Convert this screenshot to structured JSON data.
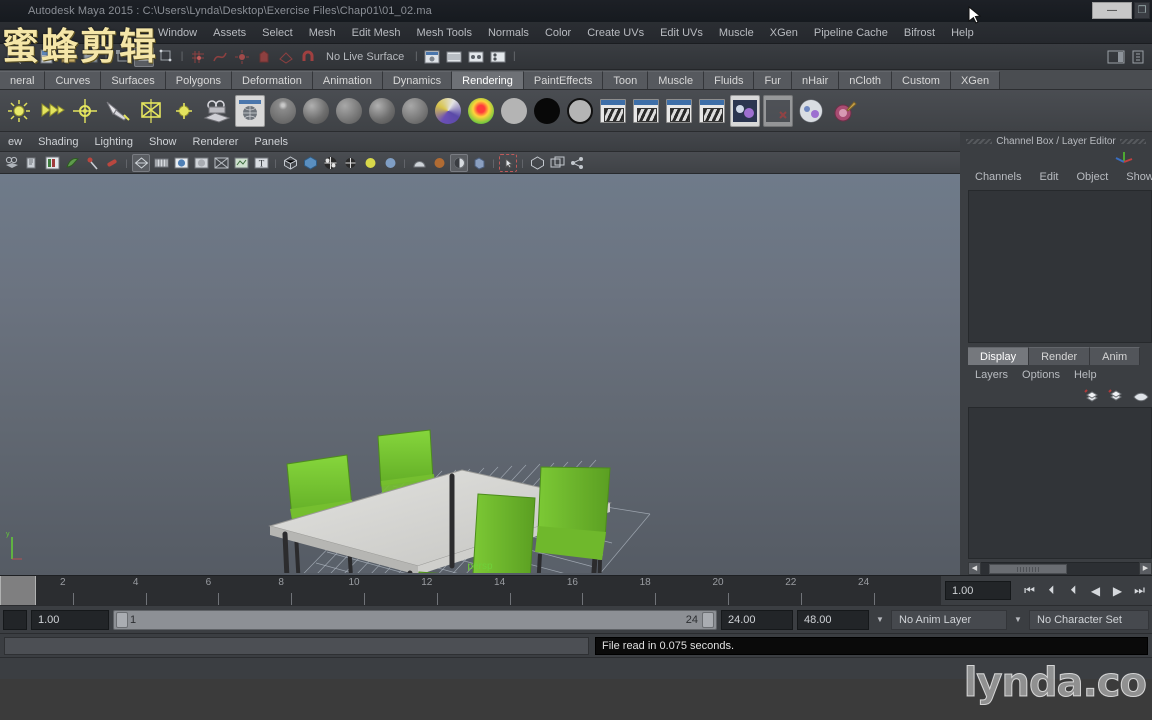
{
  "window": {
    "title": "Autodesk Maya 2015 : C:\\Users\\Lynda\\Desktop\\Exercise Files\\Chap01\\01_02.ma",
    "minimize": "—",
    "maximize": "❐",
    "close": "✕"
  },
  "menubar": {
    "items": [
      {
        "label": "Window"
      },
      {
        "label": "Assets"
      },
      {
        "label": "Select"
      },
      {
        "label": "Mesh"
      },
      {
        "label": "Edit Mesh"
      },
      {
        "label": "Mesh Tools"
      },
      {
        "label": "Normals"
      },
      {
        "label": "Color"
      },
      {
        "label": "Create UVs"
      },
      {
        "label": "Edit UVs"
      },
      {
        "label": "Muscle"
      },
      {
        "label": "XGen"
      },
      {
        "label": "Pipeline Cache"
      },
      {
        "label": "Bifrost"
      },
      {
        "label": "Help"
      }
    ]
  },
  "statusline": {
    "live_surface": "No Live Surface",
    "icons": [
      "selection-mode-menu-icon",
      "new-scene-icon",
      "open-scene-icon",
      "save-scene-icon",
      "undo-icon",
      "redo-icon",
      "select-by-hierarchy-icon",
      "select-by-object-icon",
      "select-by-component-icon",
      "snap-to-grid-icon",
      "snap-to-curve-icon",
      "snap-to-point-icon",
      "snap-to-projected-center-icon",
      "snap-to-view-plane-icon",
      "magnet-live-icon",
      "open-render-view-icon",
      "render-current-frame-icon",
      "ipr-render-icon",
      "render-settings-icon",
      "show-hide-sidebar-icon"
    ]
  },
  "shelf": {
    "tabs": [
      {
        "label": "neral",
        "active": false
      },
      {
        "label": "Curves",
        "active": false
      },
      {
        "label": "Surfaces",
        "active": false
      },
      {
        "label": "Polygons",
        "active": false
      },
      {
        "label": "Deformation",
        "active": false
      },
      {
        "label": "Animation",
        "active": false
      },
      {
        "label": "Dynamics",
        "active": false
      },
      {
        "label": "Rendering",
        "active": true
      },
      {
        "label": "PaintEffects",
        "active": false
      },
      {
        "label": "Toon",
        "active": false
      },
      {
        "label": "Muscle",
        "active": false
      },
      {
        "label": "Fluids",
        "active": false
      },
      {
        "label": "Fur",
        "active": false
      },
      {
        "label": "nHair",
        "active": false
      },
      {
        "label": "nCloth",
        "active": false
      },
      {
        "label": "Custom",
        "active": false
      },
      {
        "label": "XGen",
        "active": false
      }
    ],
    "icons": [
      "ambient-light-icon",
      "directional-light-icon",
      "point-light-icon",
      "spot-light-icon",
      "area-light-icon",
      "volume-light-icon",
      "create-camera-icon",
      "render-view-icon",
      "blinn-material-icon",
      "lambert-material-icon",
      "phong-material-icon",
      "phonge-material-icon",
      "anisotropic-material-icon",
      "layered-shader-icon",
      "ramp-shader-icon",
      "surface-shader-icon",
      "use-background-icon",
      "shading-map-icon",
      "render-current-frame-icon",
      "ipr-render-icon",
      "batch-render-icon",
      "render-settings-icon",
      "hypershade-icon",
      "delete-unused-nodes-icon",
      "render-layer-icon",
      "paint-vertex-color-icon"
    ]
  },
  "viewport": {
    "panel_menus": [
      {
        "label": "ew"
      },
      {
        "label": "Shading"
      },
      {
        "label": "Lighting"
      },
      {
        "label": "Show"
      },
      {
        "label": "Renderer"
      },
      {
        "label": "Panels"
      }
    ],
    "toolbar_icons": [
      "select-camera-icon",
      "lock-camera-icon",
      "camera-attributes-icon",
      "bookmark-icon",
      "image-plane-icon",
      "two-sided-lighting-icon",
      "grid-toggle-icon",
      "film-gate-icon",
      "resolution-gate-icon",
      "gate-mask-icon",
      "xray-toggle-icon",
      "xray-joints-icon",
      "texture-border-icon",
      "wireframe-shaded-icon",
      "smooth-shade-all-icon",
      "shaded-wireframe-icon",
      "hardware-texturing-icon",
      "use-all-lights-icon",
      "shadows-icon",
      "screen-space-ao-icon",
      "motion-blur-icon",
      "multisample-aa-icon",
      "depth-of-field-icon",
      "isolate-select-icon",
      "xray-mode-icon",
      "display-layer-icon",
      "panel-share-icon"
    ],
    "camera_label": "persp"
  },
  "channelbox": {
    "title": "Channel Box / Layer Editor",
    "menus": [
      {
        "label": "Channels"
      },
      {
        "label": "Edit"
      },
      {
        "label": "Object"
      },
      {
        "label": "Show"
      }
    ],
    "layer_tabs": [
      {
        "label": "Display",
        "active": true
      },
      {
        "label": "Render",
        "active": false
      },
      {
        "label": "Anim",
        "active": false
      }
    ],
    "layer_menus": [
      {
        "label": "Layers"
      },
      {
        "label": "Options"
      },
      {
        "label": "Help"
      }
    ],
    "layer_buttons": [
      "new-layer-icon",
      "new-layer-from-selected-icon",
      "layer-options-icon"
    ]
  },
  "timeslider": {
    "ticks": [
      2,
      4,
      6,
      8,
      10,
      12,
      14,
      16,
      18,
      20,
      22,
      24
    ],
    "current_frame": "1.00",
    "transport": [
      {
        "name": "go-to-start-button",
        "glyph": "⏮"
      },
      {
        "name": "step-back-keyframe-button",
        "glyph": "⏴"
      },
      {
        "name": "step-back-frame-button",
        "glyph": "⏴"
      },
      {
        "name": "play-backwards-button",
        "glyph": "◀"
      },
      {
        "name": "play-forwards-button",
        "glyph": "▶"
      },
      {
        "name": "step-forward-frame-button",
        "glyph": "⏭"
      }
    ]
  },
  "rangeslider": {
    "anim_start": "1.00",
    "range_start": "1",
    "range_end": "24",
    "playback_end": "24.00",
    "anim_end": "48.00",
    "anim_layer": "No Anim Layer",
    "character_set": "No Character Set"
  },
  "commandline": {
    "input_value": "",
    "result": "File read in  0.075 seconds."
  },
  "overlay": {
    "brand_cn": "蜜蜂剪辑",
    "brand_lynda": "lynda.co"
  }
}
